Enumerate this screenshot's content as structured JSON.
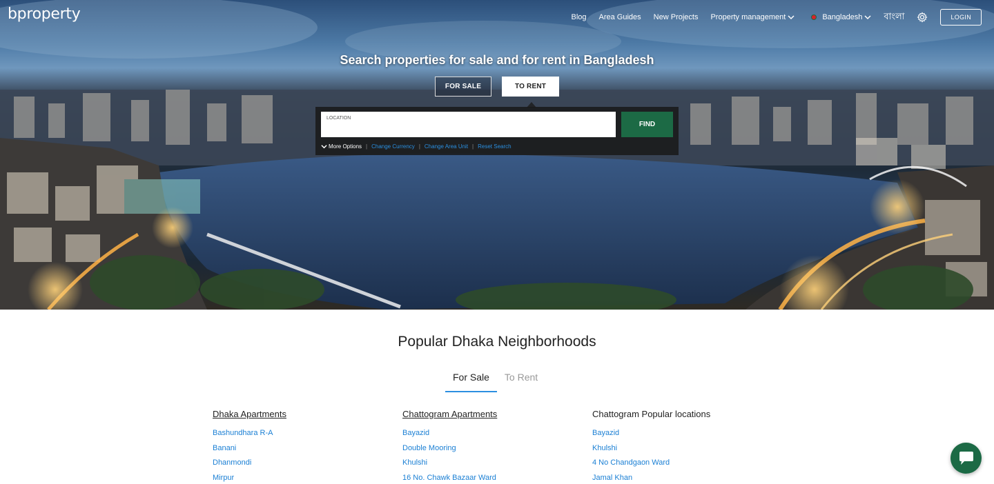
{
  "brand": {
    "logo": "bproperty"
  },
  "nav": {
    "blog": "Blog",
    "area_guides": "Area Guides",
    "new_projects": "New Projects",
    "property_management": "Property management",
    "country": "Bangladesh",
    "language": "বাংলা",
    "login": "LOGIN"
  },
  "hero": {
    "title": "Search properties for sale and for rent in Bangladesh",
    "tab_sale": "FOR SALE",
    "tab_rent": "TO RENT",
    "location_label": "LOCATION",
    "find": "FIND",
    "more_options": "More Options",
    "change_currency": "Change Currency",
    "change_area_unit": "Change Area Unit",
    "reset_search": "Reset Search"
  },
  "neighborhoods": {
    "title": "Popular Dhaka Neighborhoods",
    "tab_sale": "For Sale",
    "tab_rent": "To Rent",
    "columns": [
      {
        "heading": "Dhaka Apartments",
        "items": [
          "Bashundhara R-A",
          "Banani",
          "Dhanmondi",
          "Mirpur"
        ]
      },
      {
        "heading": "Chattogram Apartments",
        "items": [
          "Bayazid",
          "Double Mooring",
          "Khulshi",
          "16 No. Chawk Bazaar Ward"
        ]
      },
      {
        "heading": "Chattogram Popular locations",
        "items": [
          "Bayazid",
          "Khulshi",
          "4 No Chandgaon Ward",
          "Jamal Khan"
        ]
      }
    ]
  },
  "colors": {
    "brand_green": "#1c6a45",
    "link_blue": "#1a7fd4",
    "tab_underline": "#2b8fe0"
  },
  "icons": [
    "chevron-down-icon",
    "settings-gear-icon",
    "flag-icon",
    "chat-icon"
  ]
}
